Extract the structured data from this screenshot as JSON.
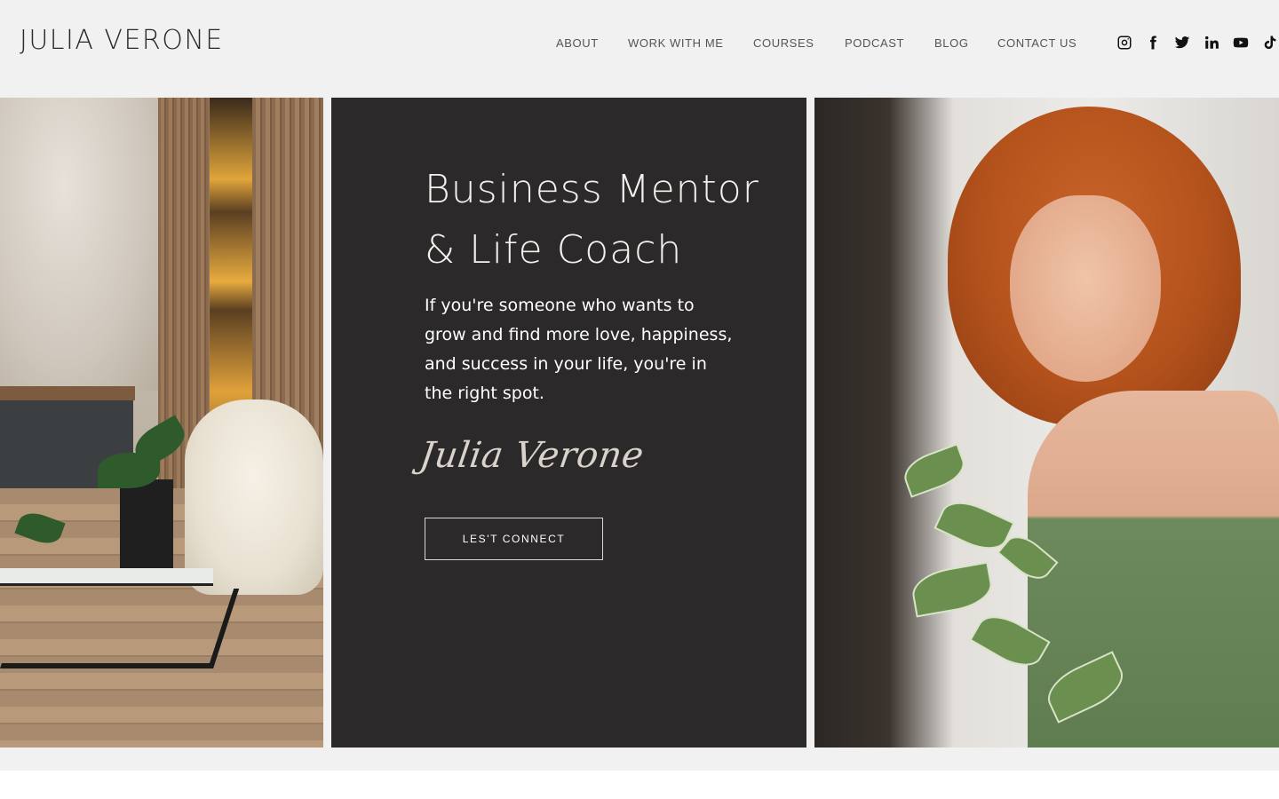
{
  "header": {
    "logo": "JULIA VERONE",
    "nav": [
      {
        "id": "about",
        "label": "ABOUT"
      },
      {
        "id": "work-with-me",
        "label": "WORK WITH ME"
      },
      {
        "id": "courses",
        "label": "COURSES"
      },
      {
        "id": "podcast",
        "label": "PODCAST"
      },
      {
        "id": "blog",
        "label": "BLOG"
      },
      {
        "id": "contact-us",
        "label": "CONTACT US"
      }
    ],
    "social": [
      "instagram-icon",
      "facebook-icon",
      "twitter-icon",
      "linkedin-icon",
      "youtube-icon",
      "tiktok-icon"
    ]
  },
  "hero": {
    "headline_line1": "Business Mentor",
    "headline_line2": "& Life Coach",
    "subtext": "If you're someone who wants to grow and find more love, happiness, and success in your life, you're in the right spot.",
    "signature": "Julia Verone",
    "cta_label": "LES'T CONNECT"
  },
  "colors": {
    "header_bg": "#f1f1f1",
    "panel_dark": "#2b292a",
    "text_light": "#ffffff",
    "nav_text": "#555555"
  }
}
